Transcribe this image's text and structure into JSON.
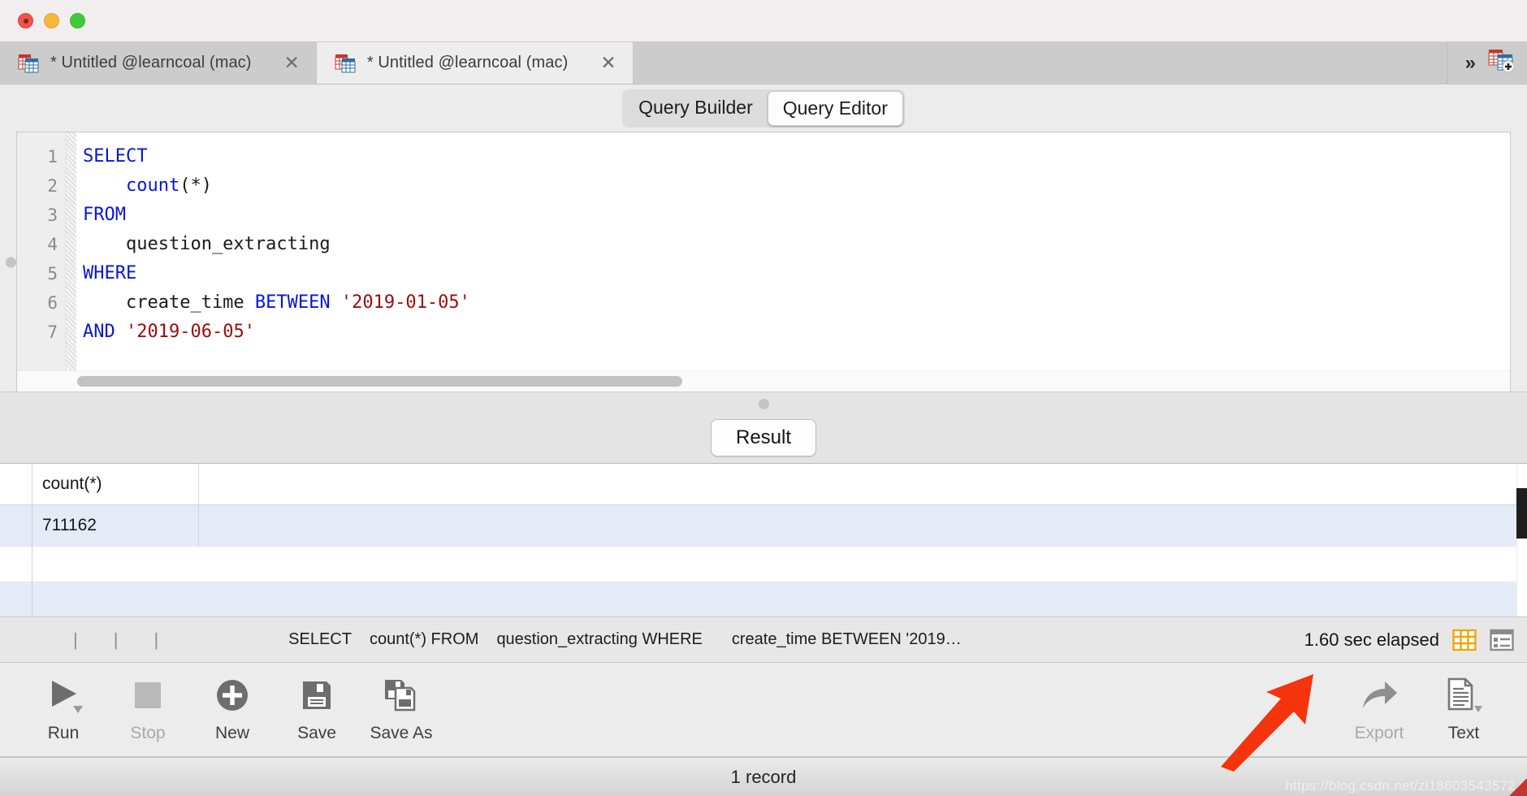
{
  "window": {
    "traffic_lights": [
      "close",
      "minimize",
      "maximize"
    ]
  },
  "tabs": {
    "items": [
      {
        "title": "* Untitled @learncoal (mac)",
        "active": false,
        "icon": "table-icon",
        "close": "✕"
      },
      {
        "title": "* Untitled @learncoal (mac)",
        "active": true,
        "icon": "table-icon",
        "close": "✕"
      }
    ],
    "overflow_icon": "chevron-double-right-icon",
    "new_tab_icon": "new-table-icon"
  },
  "mode_switch": {
    "options": [
      "Query Builder",
      "Query Editor"
    ],
    "selected": "Query Editor"
  },
  "editor": {
    "line_numbers": [
      "1",
      "2",
      "3",
      "4",
      "5",
      "6",
      "7"
    ],
    "lines": [
      [
        {
          "t": "SELECT",
          "c": "kw"
        }
      ],
      [
        {
          "t": "    ",
          "c": "pl"
        },
        {
          "t": "count",
          "c": "kw"
        },
        {
          "t": "(*)",
          "c": "pl"
        }
      ],
      [
        {
          "t": "FROM",
          "c": "kw"
        }
      ],
      [
        {
          "t": "    question_extracting",
          "c": "pl"
        }
      ],
      [
        {
          "t": "WHERE",
          "c": "kw"
        }
      ],
      [
        {
          "t": "    create_time ",
          "c": "pl"
        },
        {
          "t": "BETWEEN",
          "c": "kw"
        },
        {
          "t": " ",
          "c": "pl"
        },
        {
          "t": "'2019-01-05'",
          "c": "str"
        }
      ],
      [
        {
          "t": "AND",
          "c": "kw"
        },
        {
          "t": " ",
          "c": "pl"
        },
        {
          "t": "'2019-06-05'",
          "c": "str"
        }
      ]
    ],
    "plain_sql": "SELECT\n    count(*)\nFROM\n    question_extracting\nWHERE\n    create_time BETWEEN '2019-01-05'\nAND '2019-06-05'",
    "keyword_color": "#0716d8",
    "string_color": "#9d0b0b"
  },
  "splitter": {
    "result_button": "Result"
  },
  "results": {
    "columns": [
      "count(*)",
      ""
    ],
    "rows": [
      [
        "711162",
        ""
      ]
    ],
    "selected_row_index": 0,
    "selection_color": "#e4eaf6"
  },
  "status_strip": {
    "sql_parts": [
      "SELECT",
      "count(*) FROM",
      "question_extracting WHERE",
      "create_time BETWEEN '2019…"
    ],
    "elapsed": "1.60 sec elapsed",
    "view_grid_icon": "grid-view-icon",
    "view_form_icon": "form-view-icon",
    "grid_icon_color": "#f2a70a"
  },
  "toolbar": {
    "left_items": [
      {
        "label": "Run",
        "icon": "play-icon",
        "enabled": true,
        "has_caret": true
      },
      {
        "label": "Stop",
        "icon": "stop-icon",
        "enabled": false,
        "has_caret": false
      },
      {
        "label": "New",
        "icon": "plus-circle-icon",
        "enabled": true,
        "has_caret": false
      },
      {
        "label": "Save",
        "icon": "floppy-disk-icon",
        "enabled": true,
        "has_caret": false
      },
      {
        "label": "Save As",
        "icon": "save-as-icon",
        "enabled": true,
        "has_caret": false
      }
    ],
    "right_items": [
      {
        "label": "Export",
        "icon": "share-arrow-icon",
        "enabled": false,
        "has_caret": false
      },
      {
        "label": "Text",
        "icon": "text-document-icon",
        "enabled": true,
        "has_caret": true
      }
    ]
  },
  "footer": {
    "record_count": "1 record",
    "watermark": "https://blog.csdn.net/zl18603543572"
  },
  "annotation": {
    "arrow_color": "#f5330c",
    "points_to": "1.60 sec elapsed"
  }
}
